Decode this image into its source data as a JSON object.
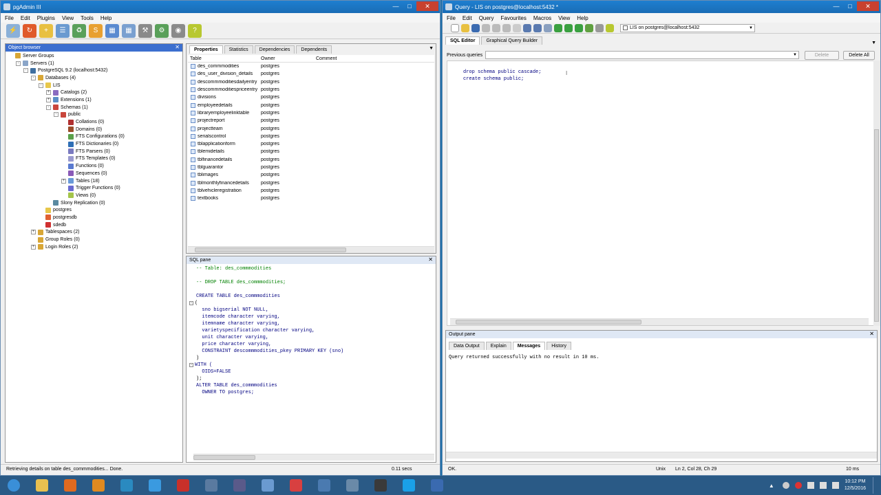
{
  "pgadmin": {
    "title": "pgAdmin III",
    "menu": [
      "File",
      "Edit",
      "Plugins",
      "View",
      "Tools",
      "Help"
    ],
    "object_browser": {
      "title": "Object browser",
      "tree": [
        {
          "label": "Server Groups",
          "indent": 0,
          "icon": "server-group-icon",
          "color": "#d8a636",
          "exp": ""
        },
        {
          "label": "Servers (1)",
          "indent": 1,
          "icon": "servers-icon",
          "color": "#8aa5c8",
          "exp": "-"
        },
        {
          "label": "PostgreSQL 9.2 (localhost:5432)",
          "indent": 2,
          "icon": "elephant-icon",
          "color": "#3f6fa0",
          "exp": "-"
        },
        {
          "label": "Databases (4)",
          "indent": 3,
          "icon": "databases-icon",
          "color": "#d8a636",
          "exp": "-"
        },
        {
          "label": "LIS",
          "indent": 4,
          "icon": "database-icon",
          "color": "#e7c74a",
          "exp": "-"
        },
        {
          "label": "Catalogs (2)",
          "indent": 5,
          "icon": "catalogs-icon",
          "color": "#8a6cc0",
          "exp": "+"
        },
        {
          "label": "Extensions (1)",
          "indent": 5,
          "icon": "extensions-icon",
          "color": "#5b8fc6",
          "exp": "+"
        },
        {
          "label": "Schemas (1)",
          "indent": 5,
          "icon": "schemas-icon",
          "color": "#c9463c",
          "exp": "-"
        },
        {
          "label": "public",
          "indent": 6,
          "icon": "schema-icon",
          "color": "#c9463c",
          "exp": "-"
        },
        {
          "label": "Collations (0)",
          "indent": 7,
          "icon": "collations-icon",
          "color": "#b03030",
          "exp": ""
        },
        {
          "label": "Domains (0)",
          "indent": 7,
          "icon": "domains-icon",
          "color": "#9a4c2a",
          "exp": ""
        },
        {
          "label": "FTS Configurations (0)",
          "indent": 7,
          "icon": "fts-config-icon",
          "color": "#5aa04a",
          "exp": ""
        },
        {
          "label": "FTS Dictionaries (0)",
          "indent": 7,
          "icon": "fts-dict-icon",
          "color": "#2f6fb6",
          "exp": ""
        },
        {
          "label": "FTS Parsers (0)",
          "indent": 7,
          "icon": "fts-parsers-icon",
          "color": "#7a7ac0",
          "exp": ""
        },
        {
          "label": "FTS Templates (0)",
          "indent": 7,
          "icon": "fts-templates-icon",
          "color": "#9a9acf",
          "exp": ""
        },
        {
          "label": "Functions (0)",
          "indent": 7,
          "icon": "functions-icon",
          "color": "#5a7ad0",
          "exp": ""
        },
        {
          "label": "Sequences (0)",
          "indent": 7,
          "icon": "sequences-icon",
          "color": "#8a5ab8",
          "exp": ""
        },
        {
          "label": "Tables (18)",
          "indent": 7,
          "icon": "tables-icon",
          "color": "#6a9ad8",
          "exp": "+"
        },
        {
          "label": "Trigger Functions (0)",
          "indent": 7,
          "icon": "trigger-functions-icon",
          "color": "#6a6ad0",
          "exp": ""
        },
        {
          "label": "Views (0)",
          "indent": 7,
          "icon": "views-icon",
          "color": "#a4c44a",
          "exp": ""
        },
        {
          "label": "Slony Replication (0)",
          "indent": 5,
          "icon": "slony-icon",
          "color": "#5a8aa0",
          "exp": ""
        },
        {
          "label": "postgres",
          "indent": 4,
          "icon": "database-icon",
          "color": "#e7c74a",
          "exp": ""
        },
        {
          "label": "postgresdb",
          "indent": 4,
          "icon": "database-icon",
          "color": "#e06030",
          "exp": ""
        },
        {
          "label": "sdedb",
          "indent": 4,
          "icon": "database-icon",
          "color": "#d03030",
          "exp": ""
        },
        {
          "label": "Tablespaces (2)",
          "indent": 3,
          "icon": "tablespaces-icon",
          "color": "#d8a636",
          "exp": "+"
        },
        {
          "label": "Group Roles (0)",
          "indent": 3,
          "icon": "group-roles-icon",
          "color": "#d8a636",
          "exp": ""
        },
        {
          "label": "Login Roles (2)",
          "indent": 3,
          "icon": "login-roles-icon",
          "color": "#d8a636",
          "exp": "+"
        }
      ]
    },
    "properties": {
      "tabs": [
        "Properties",
        "Statistics",
        "Dependencies",
        "Dependents"
      ],
      "columns": [
        "Table",
        "Owner",
        "Comment"
      ],
      "rows": [
        [
          "des_commmodities",
          "postgres"
        ],
        [
          "des_user_division_details",
          "postgres"
        ],
        [
          "descommmoditiesdailyentry",
          "postgres"
        ],
        [
          "descommmoditiespriceentry",
          "postgres"
        ],
        [
          "divisions",
          "postgres"
        ],
        [
          "employeedetails",
          "postgres"
        ],
        [
          "libraryemployeelinktable",
          "postgres"
        ],
        [
          "projectreport",
          "postgres"
        ],
        [
          "projectteam",
          "postgres"
        ],
        [
          "serialscontrol",
          "postgres"
        ],
        [
          "tblapplicationform",
          "postgres"
        ],
        [
          "tblemidetails",
          "postgres"
        ],
        [
          "tblfinancedetails",
          "postgres"
        ],
        [
          "tblguarantor",
          "postgres"
        ],
        [
          "tblimages",
          "postgres"
        ],
        [
          "tblmonthlyfinancedetails",
          "postgres"
        ],
        [
          "tblvehicleregistration",
          "postgres"
        ],
        [
          "textbooks",
          "postgres"
        ]
      ]
    },
    "sql_pane": {
      "title": "SQL pane",
      "lines": [
        {
          "t": "-- Table: des_commmodities",
          "c": "cm"
        },
        {
          "t": "",
          "c": ""
        },
        {
          "t": "-- DROP TABLE des_commmodities;",
          "c": "cm"
        },
        {
          "t": "",
          "c": ""
        },
        {
          "t": "CREATE TABLE des_commmodities",
          "c": "kw"
        },
        {
          "t": "(",
          "c": ""
        },
        {
          "t": "  sno bigserial NOT NULL,",
          "c": "kw"
        },
        {
          "t": "  itemcode character varying,",
          "c": "kw"
        },
        {
          "t": "  itemname character varying,",
          "c": "kw"
        },
        {
          "t": "  varietyspecification character varying,",
          "c": "kw"
        },
        {
          "t": "  unit character varying,",
          "c": "kw"
        },
        {
          "t": "  price character varying,",
          "c": "kw"
        },
        {
          "t": "  CONSTRAINT descommmodities_pkey PRIMARY KEY (sno)",
          "c": "kw"
        },
        {
          "t": ")",
          "c": ""
        },
        {
          "t": "WITH (",
          "c": "kw"
        },
        {
          "t": "  OIDS=FALSE",
          "c": "kw"
        },
        {
          "t": ");",
          "c": ""
        },
        {
          "t": "ALTER TABLE des_commmodities",
          "c": "kw"
        },
        {
          "t": "  OWNER TO postgres;",
          "c": "kw"
        }
      ]
    },
    "status": {
      "message": "Retrieving details on table des_commmodities... Done.",
      "time": "0.11 secs"
    }
  },
  "query": {
    "title": "Query - LIS on postgres@localhost:5432 *",
    "menu": [
      "File",
      "Edit",
      "Query",
      "Favourites",
      "Macros",
      "View",
      "Help"
    ],
    "connection": "LIS on postgres@localhost:5432",
    "tabs": [
      "SQL Editor",
      "Graphical Query Builder"
    ],
    "previous_label": "Previous queries",
    "delete_label": "Delete",
    "delete_all_label": "Delete All",
    "editor_lines": [
      "drop schema public cascade;",
      "create schema public;"
    ],
    "output": {
      "title": "Output pane",
      "tabs": [
        "Data Output",
        "Explain",
        "Messages",
        "History"
      ],
      "message": "Query returned successfully with no result in 10 ms."
    },
    "status": {
      "state": "OK.",
      "encoding": "Unix",
      "position": "Ln 2, Col 28, Ch 29",
      "time": "10 ms"
    }
  },
  "taskbar": {
    "time": "10:12 PM",
    "date": "12/5/2016",
    "apps": [
      {
        "name": "start-button",
        "color": "#3a8fd8"
      },
      {
        "name": "explorer-icon",
        "color": "#e8c050"
      },
      {
        "name": "firefox-icon",
        "color": "#e06a20"
      },
      {
        "name": "media-player-icon",
        "color": "#e08a20"
      },
      {
        "name": "network-icon",
        "color": "#2a8ac0"
      },
      {
        "name": "ie-icon",
        "color": "#3a9ae0"
      },
      {
        "name": "app-red-icon",
        "color": "#c8302a"
      },
      {
        "name": "pgadmin-icon",
        "color": "#5a7aa0"
      },
      {
        "name": "cube-icon",
        "color": "#5a5a8a"
      },
      {
        "name": "pinwheel-icon",
        "color": "#6a9ad0"
      },
      {
        "name": "opera-icon",
        "color": "#d84040"
      },
      {
        "name": "computer-icon",
        "color": "#4a7ab0"
      },
      {
        "name": "monitor-icon",
        "color": "#6a8aa8"
      },
      {
        "name": "figure-icon",
        "color": "#3a3a3a"
      },
      {
        "name": "skype-icon",
        "color": "#1aa0e8"
      },
      {
        "name": "link-icon",
        "color": "#3a6ab0"
      }
    ]
  }
}
